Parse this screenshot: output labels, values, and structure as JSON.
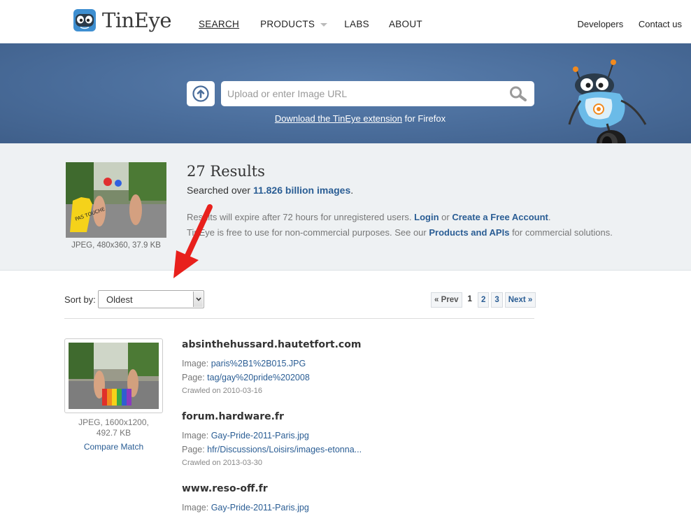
{
  "header": {
    "logo_text": "TinEye",
    "nav": {
      "search": "SEARCH",
      "products": "PRODUCTS",
      "labs": "LABS",
      "about": "ABOUT"
    },
    "right": {
      "developers": "Developers",
      "contact": "Contact us"
    }
  },
  "hero": {
    "search_placeholder": "Upload or enter Image URL",
    "extension_link": "Download the TinEye extension",
    "extension_suffix": " for Firefox"
  },
  "summary": {
    "results_title": "27 Results",
    "searched_prefix": "Searched over ",
    "searched_count": "11.826 billion images",
    "searched_suffix": ".",
    "query_meta": "JPEG, 480x360, 37.9 KB",
    "notice1_prefix": "Results will expire after 72 hours for unregistered users. ",
    "notice1_login": "Login",
    "notice1_or": " or ",
    "notice1_create": "Create a Free Account",
    "notice1_end": ".",
    "notice2_prefix": "TinEye is free to use for non-commercial purposes. See our ",
    "notice2_link": "Products and APIs",
    "notice2_suffix": " for commercial solutions."
  },
  "sort": {
    "label": "Sort by:",
    "selected": "Oldest"
  },
  "pager": {
    "prev": "« Prev",
    "current": "1",
    "pages": [
      "2",
      "3"
    ],
    "next": "Next »"
  },
  "match": {
    "meta_line1": "JPEG, 1600x1200,",
    "meta_line2": "492.7 KB",
    "compare": "Compare Match",
    "entries": [
      {
        "site": "absinthehussard.hautetfort.com",
        "image_label": "Image: ",
        "image": "paris%2B1%2B015.JPG",
        "page_label": "Page: ",
        "page": "tag/gay%20pride%202008",
        "crawled": "Crawled on 2010-03-16"
      },
      {
        "site": "forum.hardware.fr",
        "image_label": "Image: ",
        "image": "Gay-Pride-2011-Paris.jpg",
        "page_label": "Page: ",
        "page": "hfr/Discussions/Loisirs/images-etonna...",
        "crawled": "Crawled on 2013-03-30"
      },
      {
        "site": "www.reso-off.fr",
        "image_label": "Image: ",
        "image": "Gay-Pride-2011-Paris.jpg"
      }
    ]
  },
  "colors": {
    "hero_bg": "#4a6d9b",
    "link": "#2a5d94",
    "annotation_arrow": "#e8201c"
  }
}
